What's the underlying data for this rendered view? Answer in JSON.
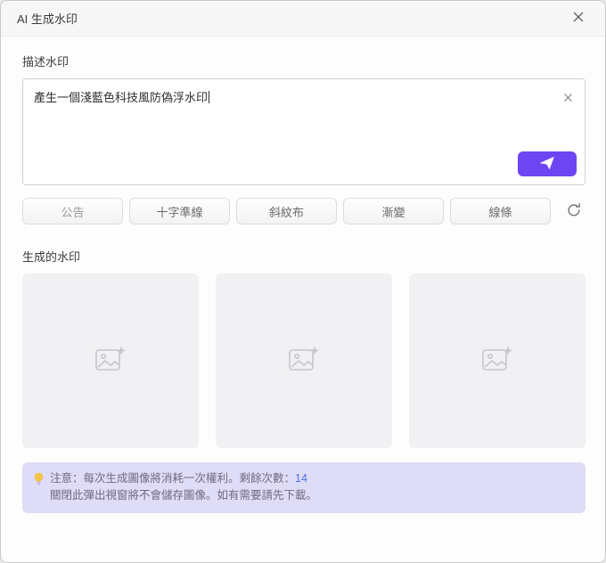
{
  "dialog": {
    "title": "AI 生成水印"
  },
  "describe": {
    "label": "描述水印",
    "input_value": "產生一個淺藍色科技風防偽浮水印"
  },
  "suggestions": {
    "chips": [
      {
        "label": "公告"
      },
      {
        "label": "十字準線"
      },
      {
        "label": "斜紋布"
      },
      {
        "label": "漸變"
      },
      {
        "label": "線條"
      }
    ]
  },
  "generated": {
    "label": "生成的水印"
  },
  "notice": {
    "line1_prefix": "注意：每次生成圖像將消耗一次權利。剩餘次數：",
    "count": "14",
    "line2": "關閉此彈出視窗將不會儲存圖像。如有需要請先下載。"
  },
  "colors": {
    "accent": "#6d45f2",
    "notice_bg": "#dfdcf7",
    "count_color": "#4a74e8"
  }
}
